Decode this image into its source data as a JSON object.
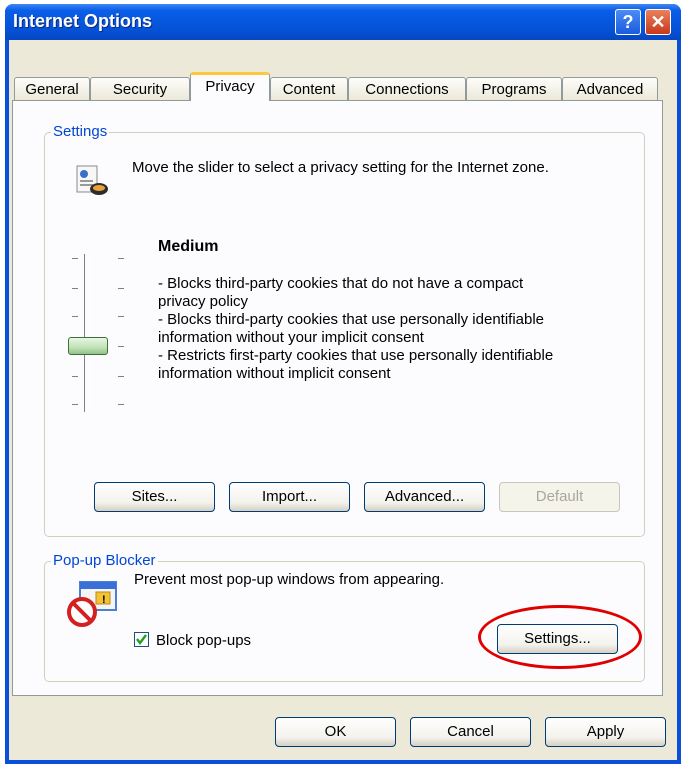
{
  "window": {
    "title": "Internet Options",
    "help_glyph": "?",
    "close_glyph": "✕"
  },
  "tabs": [
    {
      "label": "General"
    },
    {
      "label": "Security"
    },
    {
      "label": "Privacy"
    },
    {
      "label": "Content"
    },
    {
      "label": "Connections"
    },
    {
      "label": "Programs"
    },
    {
      "label": "Advanced"
    }
  ],
  "active_tab": "Privacy",
  "settings": {
    "group_label": "Settings",
    "icon": "privacy-shield-icon",
    "instruction": "Move the slider to select a privacy setting for the Internet zone.",
    "level": "Medium",
    "slider_position": "3 of 6",
    "lines": [
      "- Blocks third-party cookies that do not have a compact",
      "privacy policy",
      "- Blocks third-party cookies that use personally identifiable",
      "information without your implicit consent",
      "- Restricts first-party cookies that use personally identifiable",
      "information without implicit consent"
    ],
    "buttons": {
      "sites": "Sites...",
      "import": "Import...",
      "advanced": "Advanced...",
      "default": "Default"
    }
  },
  "popup": {
    "group_label": "Pop-up Blocker",
    "icon": "popup-blocker-icon",
    "description": "Prevent most pop-up windows from appearing.",
    "checkbox_label": "Block pop-ups",
    "checked": true,
    "settings_button": "Settings..."
  },
  "footer": {
    "ok": "OK",
    "cancel": "Cancel",
    "apply": "Apply"
  },
  "colors": {
    "title_bar": "#0a5ee8",
    "dialog_bg": "#ece9d8",
    "group_label": "#0046d5",
    "annotation_circle": "#e00000",
    "active_tab_accent": "#ffc83c"
  }
}
